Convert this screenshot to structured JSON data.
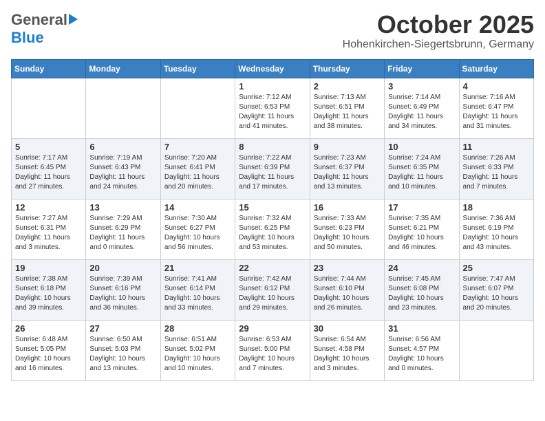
{
  "header": {
    "logo_general": "General",
    "logo_blue": "Blue",
    "month_title": "October 2025",
    "location": "Hohenkirchen-Siegertsbrunn, Germany"
  },
  "weekdays": [
    "Sunday",
    "Monday",
    "Tuesday",
    "Wednesday",
    "Thursday",
    "Friday",
    "Saturday"
  ],
  "weeks": [
    [
      {
        "day": "",
        "info": ""
      },
      {
        "day": "",
        "info": ""
      },
      {
        "day": "",
        "info": ""
      },
      {
        "day": "1",
        "info": "Sunrise: 7:12 AM\nSunset: 6:53 PM\nDaylight: 11 hours and 41 minutes."
      },
      {
        "day": "2",
        "info": "Sunrise: 7:13 AM\nSunset: 6:51 PM\nDaylight: 11 hours and 38 minutes."
      },
      {
        "day": "3",
        "info": "Sunrise: 7:14 AM\nSunset: 6:49 PM\nDaylight: 11 hours and 34 minutes."
      },
      {
        "day": "4",
        "info": "Sunrise: 7:16 AM\nSunset: 6:47 PM\nDaylight: 11 hours and 31 minutes."
      }
    ],
    [
      {
        "day": "5",
        "info": "Sunrise: 7:17 AM\nSunset: 6:45 PM\nDaylight: 11 hours and 27 minutes."
      },
      {
        "day": "6",
        "info": "Sunrise: 7:19 AM\nSunset: 6:43 PM\nDaylight: 11 hours and 24 minutes."
      },
      {
        "day": "7",
        "info": "Sunrise: 7:20 AM\nSunset: 6:41 PM\nDaylight: 11 hours and 20 minutes."
      },
      {
        "day": "8",
        "info": "Sunrise: 7:22 AM\nSunset: 6:39 PM\nDaylight: 11 hours and 17 minutes."
      },
      {
        "day": "9",
        "info": "Sunrise: 7:23 AM\nSunset: 6:37 PM\nDaylight: 11 hours and 13 minutes."
      },
      {
        "day": "10",
        "info": "Sunrise: 7:24 AM\nSunset: 6:35 PM\nDaylight: 11 hours and 10 minutes."
      },
      {
        "day": "11",
        "info": "Sunrise: 7:26 AM\nSunset: 6:33 PM\nDaylight: 11 hours and 7 minutes."
      }
    ],
    [
      {
        "day": "12",
        "info": "Sunrise: 7:27 AM\nSunset: 6:31 PM\nDaylight: 11 hours and 3 minutes."
      },
      {
        "day": "13",
        "info": "Sunrise: 7:29 AM\nSunset: 6:29 PM\nDaylight: 11 hours and 0 minutes."
      },
      {
        "day": "14",
        "info": "Sunrise: 7:30 AM\nSunset: 6:27 PM\nDaylight: 10 hours and 56 minutes."
      },
      {
        "day": "15",
        "info": "Sunrise: 7:32 AM\nSunset: 6:25 PM\nDaylight: 10 hours and 53 minutes."
      },
      {
        "day": "16",
        "info": "Sunrise: 7:33 AM\nSunset: 6:23 PM\nDaylight: 10 hours and 50 minutes."
      },
      {
        "day": "17",
        "info": "Sunrise: 7:35 AM\nSunset: 6:21 PM\nDaylight: 10 hours and 46 minutes."
      },
      {
        "day": "18",
        "info": "Sunrise: 7:36 AM\nSunset: 6:19 PM\nDaylight: 10 hours and 43 minutes."
      }
    ],
    [
      {
        "day": "19",
        "info": "Sunrise: 7:38 AM\nSunset: 6:18 PM\nDaylight: 10 hours and 39 minutes."
      },
      {
        "day": "20",
        "info": "Sunrise: 7:39 AM\nSunset: 6:16 PM\nDaylight: 10 hours and 36 minutes."
      },
      {
        "day": "21",
        "info": "Sunrise: 7:41 AM\nSunset: 6:14 PM\nDaylight: 10 hours and 33 minutes."
      },
      {
        "day": "22",
        "info": "Sunrise: 7:42 AM\nSunset: 6:12 PM\nDaylight: 10 hours and 29 minutes."
      },
      {
        "day": "23",
        "info": "Sunrise: 7:44 AM\nSunset: 6:10 PM\nDaylight: 10 hours and 26 minutes."
      },
      {
        "day": "24",
        "info": "Sunrise: 7:45 AM\nSunset: 6:08 PM\nDaylight: 10 hours and 23 minutes."
      },
      {
        "day": "25",
        "info": "Sunrise: 7:47 AM\nSunset: 6:07 PM\nDaylight: 10 hours and 20 minutes."
      }
    ],
    [
      {
        "day": "26",
        "info": "Sunrise: 6:48 AM\nSunset: 5:05 PM\nDaylight: 10 hours and 16 minutes."
      },
      {
        "day": "27",
        "info": "Sunrise: 6:50 AM\nSunset: 5:03 PM\nDaylight: 10 hours and 13 minutes."
      },
      {
        "day": "28",
        "info": "Sunrise: 6:51 AM\nSunset: 5:02 PM\nDaylight: 10 hours and 10 minutes."
      },
      {
        "day": "29",
        "info": "Sunrise: 6:53 AM\nSunset: 5:00 PM\nDaylight: 10 hours and 7 minutes."
      },
      {
        "day": "30",
        "info": "Sunrise: 6:54 AM\nSunset: 4:58 PM\nDaylight: 10 hours and 3 minutes."
      },
      {
        "day": "31",
        "info": "Sunrise: 6:56 AM\nSunset: 4:57 PM\nDaylight: 10 hours and 0 minutes."
      },
      {
        "day": "",
        "info": ""
      }
    ]
  ]
}
